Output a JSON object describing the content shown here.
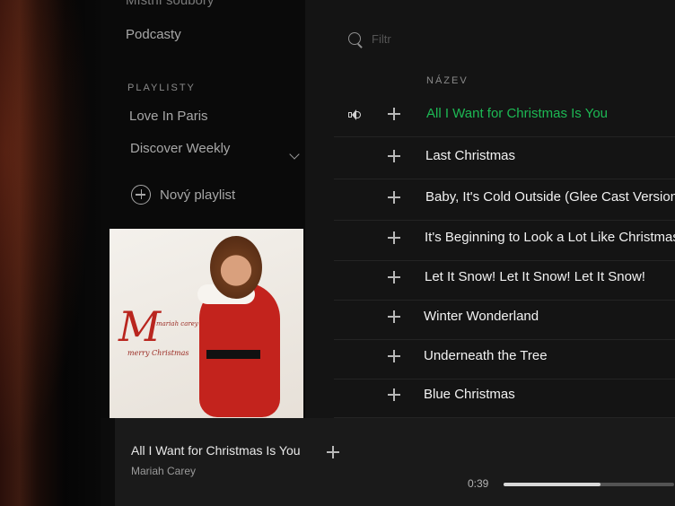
{
  "sidebar": {
    "top_item": "Místní soubory",
    "podcasts": "Podcasty",
    "playlists_header": "PLAYLISTY",
    "playlists": [
      {
        "label": "Love In Paris"
      },
      {
        "label": "Discover Weekly"
      }
    ],
    "new_playlist_label": "Nový playlist"
  },
  "search": {
    "placeholder": "Filtr"
  },
  "tracklist": {
    "column_header": "NÁZEV",
    "tracks": [
      {
        "title": "All I Want for Christmas Is You",
        "playing": true
      },
      {
        "title": "Last Christmas",
        "playing": false
      },
      {
        "title": "Baby, It's Cold Outside (Glee Cast Version)",
        "playing": false
      },
      {
        "title": "It's Beginning to Look a Lot Like Christmas",
        "playing": false
      },
      {
        "title": "Let It Snow! Let It Snow! Let It Snow!",
        "playing": false
      },
      {
        "title": "Winter Wonderland",
        "playing": false
      },
      {
        "title": "Underneath the Tree",
        "playing": false
      },
      {
        "title": "Blue Christmas",
        "playing": false
      }
    ]
  },
  "player": {
    "track_title": "All I Want for Christmas Is You",
    "artist": "Mariah Carey",
    "elapsed": "0:39",
    "progress_fraction": 0.57
  },
  "album_art": {
    "script_text": "merry Christmas",
    "artist_script": "mariah carey"
  },
  "colors": {
    "accent_green": "#1db954",
    "background": "#121212"
  }
}
